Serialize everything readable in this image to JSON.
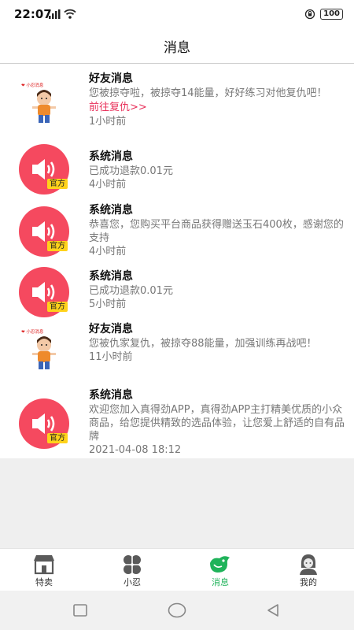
{
  "status_bar": {
    "time": "22:07",
    "battery": "100",
    "network": "5G"
  },
  "header": {
    "title": "消息"
  },
  "messages": [
    {
      "avatar": "character-avatar",
      "title": "好友消息",
      "text": "您被掠夺啦，被掠夺14能量，好好练习对他复仇吧！",
      "link": "前往复仇>>",
      "time": "1小时前"
    },
    {
      "avatar": "speaker-avatar",
      "badge": "官方",
      "title": "系统消息",
      "text": "已成功退款0.01元",
      "time": "4小时前"
    },
    {
      "avatar": "speaker-avatar",
      "badge": "官方",
      "title": "系统消息",
      "text": "恭喜您，您购买平台商品获得赠送玉石400枚，感谢您的支持",
      "time": "4小时前"
    },
    {
      "avatar": "speaker-avatar",
      "badge": "官方",
      "title": "系统消息",
      "text": "已成功退款0.01元",
      "time": "5小时前"
    },
    {
      "avatar": "character-avatar",
      "title": "好友消息",
      "text": "您被仇家复仇，被掠夺88能量，加强训练再战吧！",
      "time": "11小时前"
    },
    {
      "avatar": "speaker-avatar",
      "badge": "官方",
      "title": "系统消息",
      "text": "欢迎您加入真得劲APP，真得劲APP主打精美优质的小众商品，给您提供精致的选品体验，让您爱上舒适的自有品牌",
      "time": "2021-04-08 18:12"
    }
  ],
  "tabs": [
    {
      "label": "特卖",
      "icon": "shop-icon"
    },
    {
      "label": "小忍",
      "icon": "clover-icon"
    },
    {
      "label": "消息",
      "icon": "bird-icon",
      "active": true
    },
    {
      "label": "我的",
      "icon": "profile-icon"
    }
  ],
  "colors": {
    "accent_green": "#1fb35a",
    "badge_red": "#f5495f",
    "badge_yellow": "#ffd21a",
    "link_pink": "#e8305a"
  }
}
